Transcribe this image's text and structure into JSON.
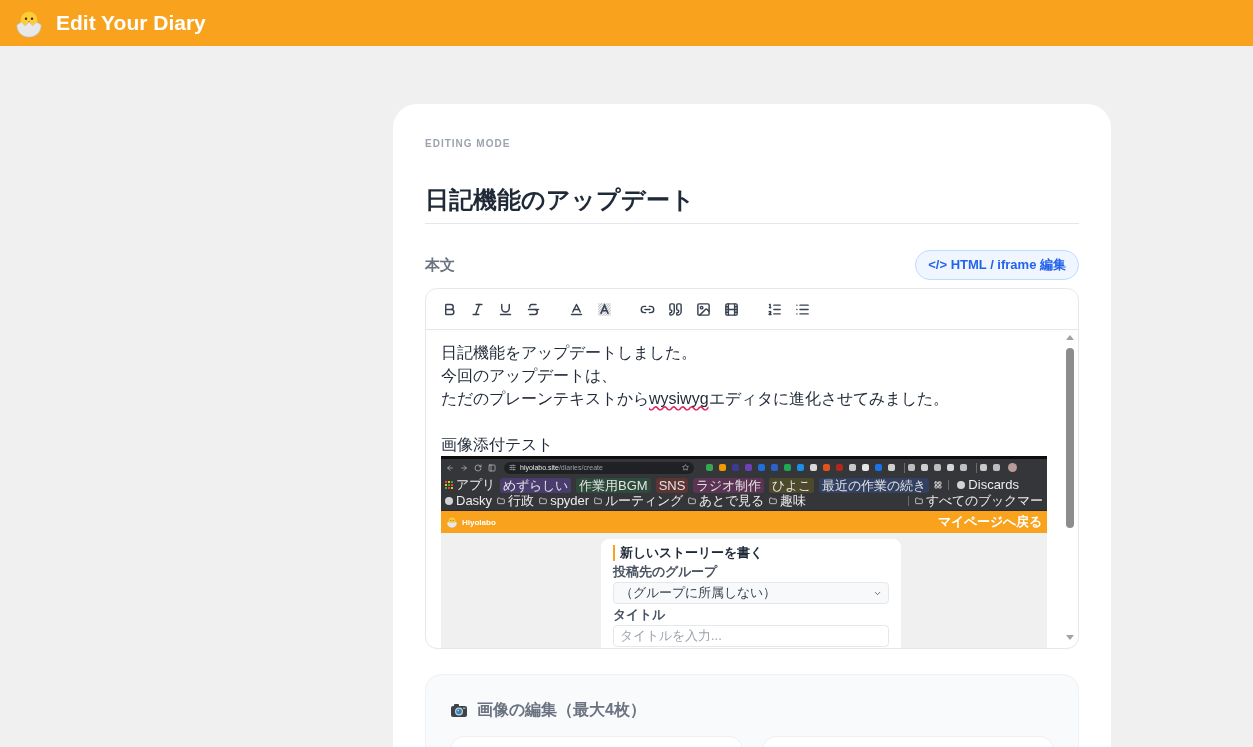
{
  "header": {
    "title": "Edit Your Diary"
  },
  "editor": {
    "mode_label": "EDITING MODE",
    "title": "日記機能のアップデート"
  },
  "body_field": {
    "label": "本文",
    "html_button": "</> HTML / iframe 編集"
  },
  "content": {
    "blocks": [
      {
        "kind": "text",
        "segments": [
          {
            "text": "日記機能をアップデートしました。",
            "misspelled": false
          }
        ]
      },
      {
        "kind": "text",
        "segments": [
          {
            "text": "今回のアップデートは、",
            "misspelled": false
          }
        ]
      },
      {
        "kind": "text",
        "segments": [
          {
            "text": "ただのプレーンテキストから",
            "misspelled": false
          },
          {
            "text": "wysiwyg",
            "misspelled": true
          },
          {
            "text": "エディタに進化させてみました。",
            "misspelled": false
          }
        ]
      },
      {
        "kind": "blank"
      },
      {
        "kind": "text",
        "segments": [
          {
            "text": "画像添付テスト",
            "misspelled": false
          }
        ]
      },
      {
        "kind": "screenshot",
        "address": {
          "host": "hiyolabo.site",
          "path": "/diaries/create"
        },
        "bookmarks": [
          {
            "kind": "apps",
            "label": "アプリ"
          },
          {
            "kind": "group",
            "label": "めずらしい",
            "color": "#4a3d6e"
          },
          {
            "kind": "group",
            "label": "作業用BGM",
            "color": "#2e4a3b"
          },
          {
            "kind": "group",
            "label": "SNS",
            "color": "#5c3434"
          },
          {
            "kind": "group",
            "label": "ラジオ制作",
            "color": "#5a3452"
          },
          {
            "kind": "group",
            "label": "ひよこ",
            "color": "#4d4a2c"
          },
          {
            "kind": "group",
            "label": "最近の作業の続き",
            "color": "#33405f"
          },
          {
            "kind": "groups_menu"
          },
          {
            "kind": "site",
            "label": "Discards"
          },
          {
            "kind": "site",
            "label": "Dasky"
          },
          {
            "kind": "folder",
            "label": "行政"
          },
          {
            "kind": "folder",
            "label": "spyder"
          },
          {
            "kind": "folder",
            "label": "ルーティング"
          },
          {
            "kind": "folder",
            "label": "あとで見る"
          },
          {
            "kind": "folder",
            "label": "趣味"
          },
          {
            "kind": "all_bookmarks",
            "label": "すべてのブックマー"
          }
        ],
        "site_header": {
          "brand": "Hiyolabo",
          "link": "マイページへ戻る"
        },
        "form": {
          "heading": "新しいストーリーを書く",
          "fields": [
            {
              "kind": "select",
              "label": "投稿先のグループ",
              "value": "（グループに所属しない）"
            },
            {
              "kind": "input",
              "label": "タイトル",
              "placeholder": "タイトルを入力..."
            }
          ]
        }
      }
    ]
  },
  "image_section": {
    "title": "画像の編集（最大4枚）"
  }
}
